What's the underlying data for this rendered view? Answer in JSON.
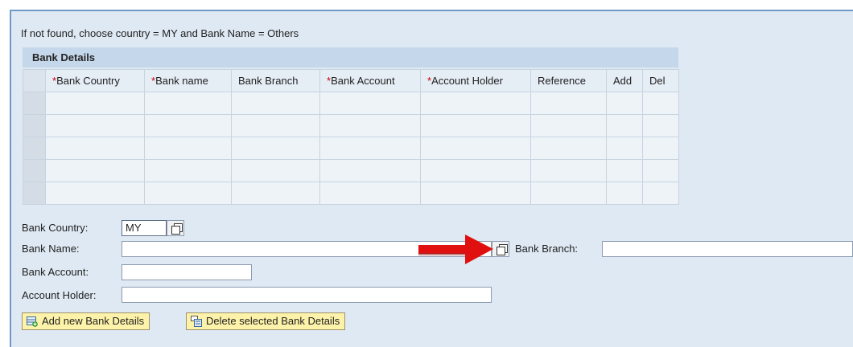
{
  "info_text": "If not found, choose country = MY and Bank Name = Others",
  "table": {
    "title": "Bank Details",
    "columns": [
      {
        "label": "Bank Country",
        "required": true
      },
      {
        "label": "Bank name",
        "required": true
      },
      {
        "label": "Bank Branch",
        "required": false
      },
      {
        "label": "Bank Account",
        "required": true
      },
      {
        "label": "Account Holder",
        "required": true
      },
      {
        "label": "Reference",
        "required": false
      },
      {
        "label": "Add",
        "required": false
      },
      {
        "label": "Del",
        "required": false
      }
    ],
    "empty_rows": 5
  },
  "form": {
    "bank_country_label": "Bank Country:",
    "bank_country_value": "MY",
    "bank_name_label": "Bank Name:",
    "bank_name_value": "",
    "bank_branch_label": "Bank Branch:",
    "bank_branch_value": "",
    "bank_account_label": "Bank Account:",
    "bank_account_value": "",
    "account_holder_label": "Account Holder:",
    "account_holder_value": ""
  },
  "buttons": {
    "add_label": "Add new Bank Details",
    "delete_label": "Delete selected Bank Details"
  },
  "colors": {
    "required_marker": "#cc0000",
    "annotation_arrow": "#e01010",
    "button_bg": "#fdf2a9"
  }
}
